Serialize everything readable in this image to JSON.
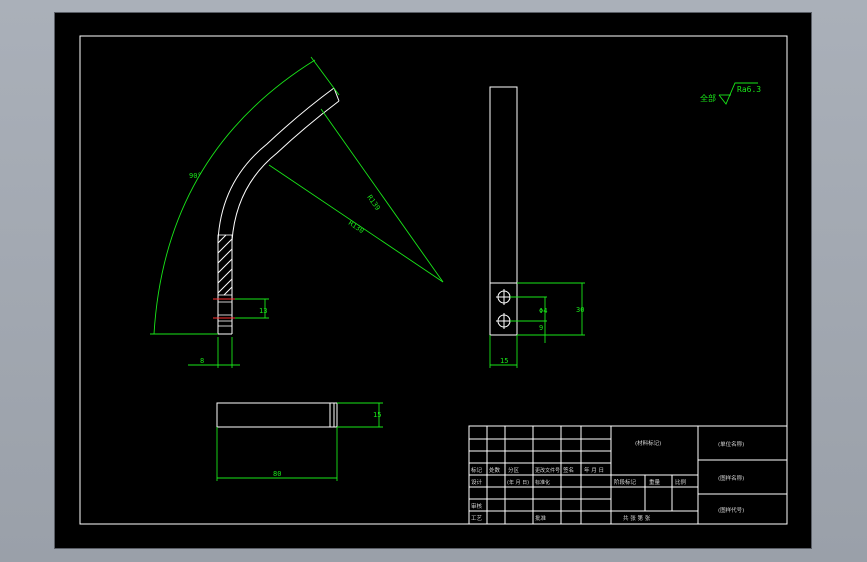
{
  "drawing": {
    "surface_roughness": {
      "prefix": "全部",
      "value": "Ra6.3"
    },
    "dimensions": {
      "angle": "90°",
      "radius_outer": "R139",
      "radius_inner": "R130",
      "arc_gap": "13",
      "arc_width": "8",
      "hole_dia": "Φ4",
      "hole_pitch": "9",
      "side_height": "30",
      "side_width": "15",
      "bottom_height": "15",
      "bottom_length": "80"
    }
  },
  "title_block": {
    "row_labels": [
      "标记",
      "设计",
      "审核",
      "工艺"
    ],
    "marks": {
      "count": "处数",
      "zone": "分区",
      "change_doc": "更改文件号",
      "signature": "签名",
      "date": "年 月 日",
      "standardization": "标准化",
      "approve": "批准",
      "date2": "(年 月 日)"
    },
    "material": "(材料标记)",
    "company": "(单位名称)",
    "drawing_name": "(图样名称)",
    "drawing_code": "(图样代号)",
    "stage_mark": "阶段标记",
    "weight": "重量",
    "scale": "比例",
    "sheets": "共 张 第 张"
  }
}
